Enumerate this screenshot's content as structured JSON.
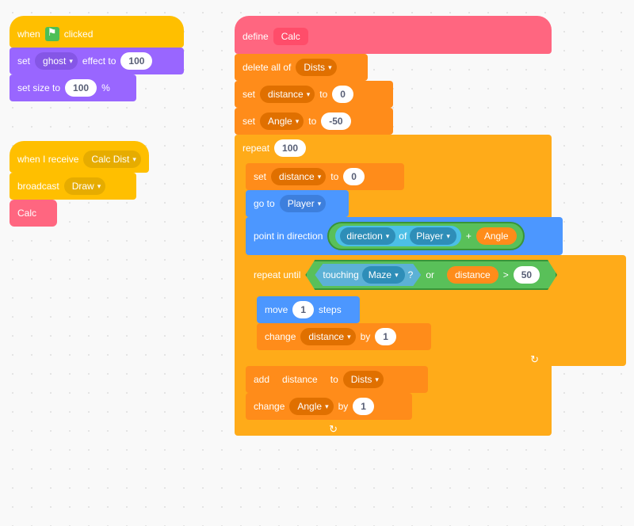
{
  "stack1": {
    "hat_when": "when",
    "hat_clicked": "clicked",
    "set_effect_prefix": "set",
    "ghost": "ghost",
    "effect_to": "effect to",
    "ghost_val": "100",
    "set_size_to": "set size to",
    "size_val": "100",
    "percent": "%"
  },
  "stack2": {
    "hat_receive": "when I receive",
    "msg": "Calc Dist",
    "broadcast": "broadcast",
    "draw": "Draw",
    "calc_call": "Calc"
  },
  "stack3": {
    "define": "define",
    "proc_name": "Calc",
    "delete_all_of": "delete all of",
    "dists": "Dists",
    "set": "set",
    "distance": "distance",
    "to": "to",
    "zero": "0",
    "angle": "Angle",
    "neg50": "-50",
    "repeat": "repeat",
    "repeat_count": "100",
    "go_to": "go to",
    "player": "Player",
    "point_in_direction": "point in direction",
    "direction": "direction",
    "of": "of",
    "plus": "+",
    "repeat_until": "repeat until",
    "touching": "touching",
    "maze": "Maze",
    "question": "?",
    "or": "or",
    "gt": ">",
    "fifty": "50",
    "move": "move",
    "one": "1",
    "steps": "steps",
    "change": "change",
    "by": "by",
    "add": "add",
    "to2": "to"
  }
}
